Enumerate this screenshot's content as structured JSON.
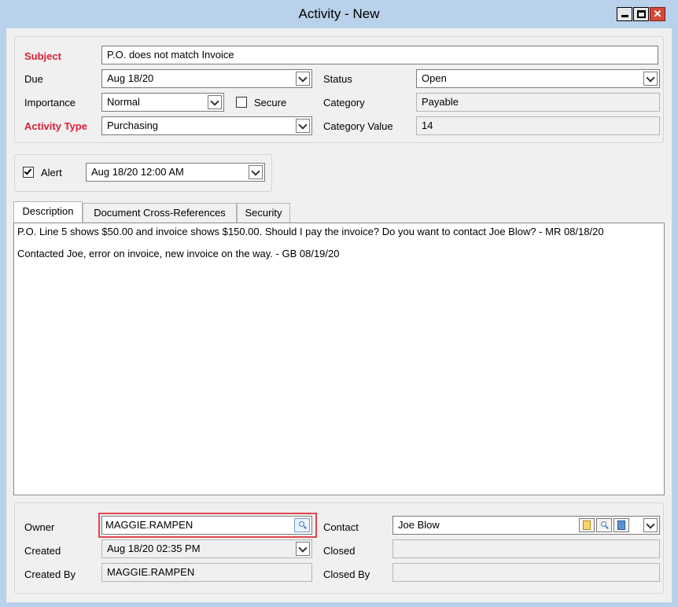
{
  "window": {
    "title": "Activity - New",
    "min_icon": "minimize-icon",
    "max_icon": "maximize-icon",
    "close_glyph": "✕"
  },
  "form": {
    "subject_label": "Subject",
    "subject_value": "P.O. does not match Invoice",
    "due_label": "Due",
    "due_value": "Aug 18/20",
    "status_label": "Status",
    "status_value": "Open",
    "importance_label": "Importance",
    "importance_value": "Normal",
    "secure_label": "Secure",
    "category_label": "Category",
    "category_value": "Payable",
    "activity_type_label": "Activity Type",
    "activity_type_value": "Purchasing",
    "category_value_label": "Category Value",
    "category_value_value": "14"
  },
  "alert": {
    "label": "Alert",
    "checked": true,
    "value": "Aug 18/20 12:00 AM"
  },
  "tabs": [
    {
      "label": "Description",
      "active": true
    },
    {
      "label": "Document Cross-References",
      "active": false
    },
    {
      "label": "Security",
      "active": false
    }
  ],
  "description": {
    "line1": "P.O. Line 5 shows $50.00 and invoice shows $150.00. Should I pay the invoice? Do you want to contact Joe Blow? - MR 08/18/20",
    "line2": "Contacted Joe, error on invoice, new invoice on the way. - GB 08/19/20"
  },
  "footer": {
    "owner_label": "Owner",
    "owner_value": "MAGGIE.RAMPEN",
    "contact_label": "Contact",
    "contact_value": "Joe Blow",
    "created_label": "Created",
    "created_value": "Aug 18/20 02:35 PM",
    "closed_label": "Closed",
    "closed_value": "",
    "created_by_label": "Created By",
    "created_by_value": "MAGGIE.RAMPEN",
    "closed_by_label": "Closed By",
    "closed_by_value": ""
  },
  "colors": {
    "title_bg": "#b9d1ea",
    "required_label": "#d81e37",
    "highlight_border": "#e0464c",
    "close_button": "#d24a3b"
  }
}
